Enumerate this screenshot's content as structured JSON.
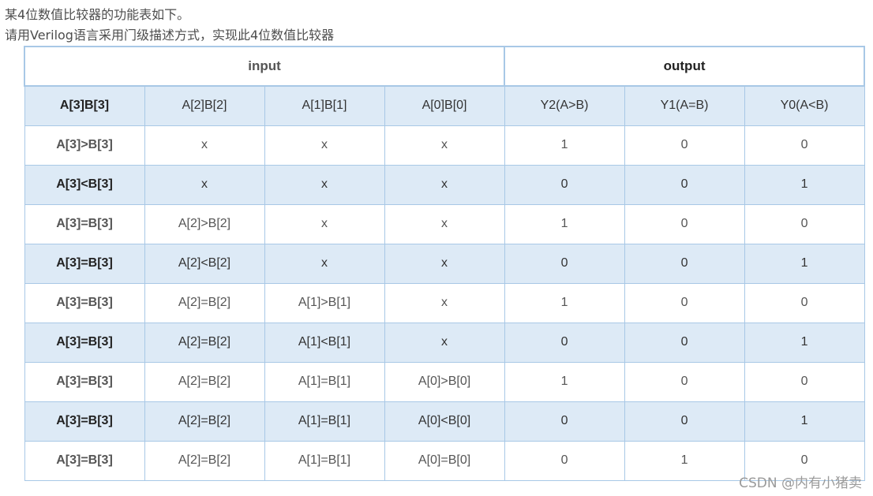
{
  "intro": {
    "line1": "某4位数值比较器的功能表如下。",
    "line2": "请用Verilog语言采用门级描述方式，实现此4位数值比较器"
  },
  "table": {
    "group_headers": [
      "input",
      "output"
    ],
    "column_headers": [
      "A[3]B[3]",
      "A[2]B[2]",
      "A[1]B[1]",
      "A[0]B[0]",
      "Y2(A>B)",
      "Y1(A=B)",
      "Y0(A<B)"
    ],
    "rows": [
      [
        "A[3]>B[3]",
        "x",
        "x",
        "x",
        "1",
        "0",
        "0"
      ],
      [
        "A[3]<B[3]",
        "x",
        "x",
        "x",
        "0",
        "0",
        "1"
      ],
      [
        "A[3]=B[3]",
        "A[2]>B[2]",
        "x",
        "x",
        "1",
        "0",
        "0"
      ],
      [
        "A[3]=B[3]",
        "A[2]<B[2]",
        "x",
        "x",
        "0",
        "0",
        "1"
      ],
      [
        "A[3]=B[3]",
        "A[2]=B[2]",
        "A[1]>B[1]",
        "x",
        "1",
        "0",
        "0"
      ],
      [
        "A[3]=B[3]",
        "A[2]=B[2]",
        "A[1]<B[1]",
        "x",
        "0",
        "0",
        "1"
      ],
      [
        "A[3]=B[3]",
        "A[2]=B[2]",
        "A[1]=B[1]",
        "A[0]>B[0]",
        "1",
        "0",
        "0"
      ],
      [
        "A[3]=B[3]",
        "A[2]=B[2]",
        "A[1]=B[1]",
        "A[0]<B[0]",
        "0",
        "0",
        "1"
      ],
      [
        "A[3]=B[3]",
        "A[2]=B[2]",
        "A[1]=B[1]",
        "A[0]=B[0]",
        "0",
        "1",
        "0"
      ]
    ]
  },
  "watermark": "CSDN @内有小猪卖",
  "colors": {
    "border": "#a8c8e6",
    "alt_row": "#ddeaf6"
  }
}
